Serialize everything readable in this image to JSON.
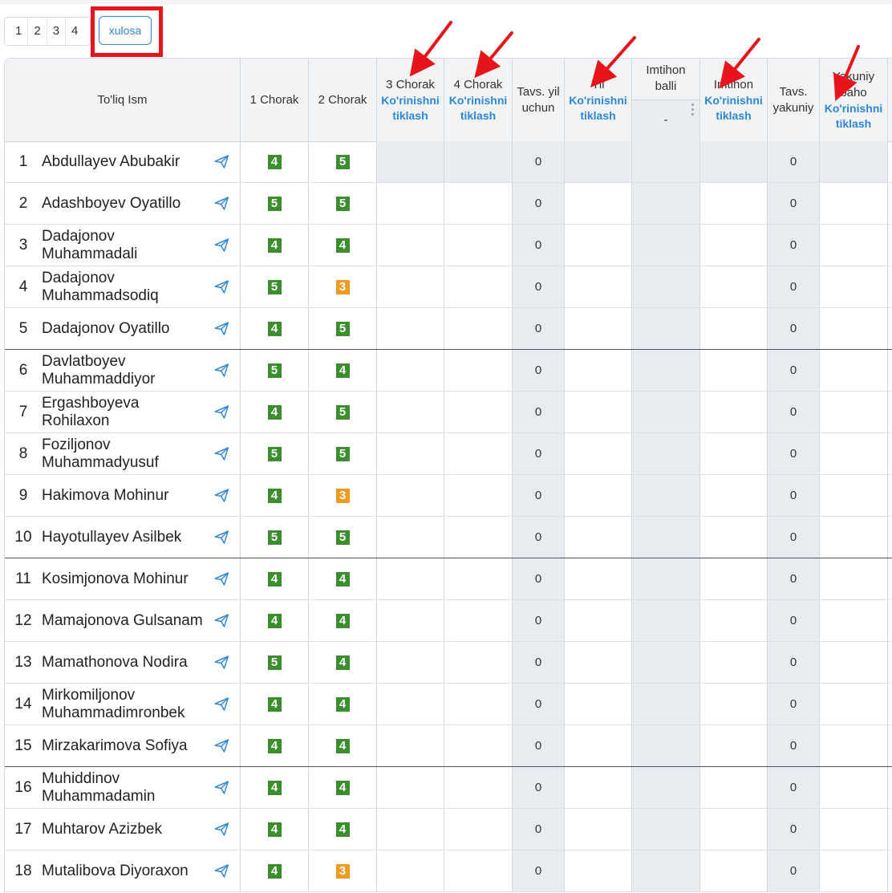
{
  "tabs": [
    {
      "label": "1"
    },
    {
      "label": "2"
    },
    {
      "label": "3"
    },
    {
      "label": "4"
    }
  ],
  "active_tab": "xulosa",
  "headers": {
    "name": "To'liq Ism",
    "q1": "1 Chorak",
    "q2": "2 Chorak",
    "q3": "3 Chorak",
    "q4": "4 Chorak",
    "recommended_year": "Tavs. yil uchun",
    "year": "Yil",
    "exam_score": "Imtihon balli",
    "exam_score_value": "-",
    "exam": "Imtihon",
    "recommended_final": "Tavs. yakuniy",
    "final_grade": "Yakuniy baho",
    "restore_view": "Ko'rinishni tiklash"
  },
  "colors": {
    "accent": "#2f86d8",
    "grade_good": "#3a8e2b",
    "grade_mid": "#f19a22",
    "annotation": "#e8141b"
  },
  "students": [
    {
      "n": "1",
      "name": "Abdullayev Abubakir",
      "q1": "4",
      "q2": "5",
      "rec_year": "0",
      "rec_final": "0"
    },
    {
      "n": "2",
      "name": "Adashboyev Oyatillo",
      "q1": "5",
      "q2": "5",
      "rec_year": "0",
      "rec_final": "0"
    },
    {
      "n": "3",
      "name": "Dadajonov Muhammadali",
      "q1": "4",
      "q2": "4",
      "rec_year": "0",
      "rec_final": "0"
    },
    {
      "n": "4",
      "name": "Dadajonov Muhammadsodiq",
      "q1": "5",
      "q2": "3",
      "rec_year": "0",
      "rec_final": "0"
    },
    {
      "n": "5",
      "name": "Dadajonov Oyatillo",
      "q1": "4",
      "q2": "5",
      "rec_year": "0",
      "rec_final": "0"
    },
    {
      "n": "6",
      "name": "Davlatboyev Muhammaddiyor",
      "q1": "5",
      "q2": "4",
      "rec_year": "0",
      "rec_final": "0"
    },
    {
      "n": "7",
      "name": "Ergashboyeva Rohilaxon",
      "q1": "4",
      "q2": "5",
      "rec_year": "0",
      "rec_final": "0"
    },
    {
      "n": "8",
      "name": "Foziljonov Muhammadyusuf",
      "q1": "5",
      "q2": "5",
      "rec_year": "0",
      "rec_final": "0"
    },
    {
      "n": "9",
      "name": "Hakimova Mohinur",
      "q1": "4",
      "q2": "3",
      "rec_year": "0",
      "rec_final": "0"
    },
    {
      "n": "10",
      "name": "Hayotullayev Asilbek",
      "q1": "5",
      "q2": "5",
      "rec_year": "0",
      "rec_final": "0"
    },
    {
      "n": "11",
      "name": "Kosimjonova Mohinur",
      "q1": "4",
      "q2": "4",
      "rec_year": "0",
      "rec_final": "0"
    },
    {
      "n": "12",
      "name": "Mamajonova Gulsanam",
      "q1": "4",
      "q2": "4",
      "rec_year": "0",
      "rec_final": "0"
    },
    {
      "n": "13",
      "name": "Mamathonova Nodira",
      "q1": "5",
      "q2": "4",
      "rec_year": "0",
      "rec_final": "0"
    },
    {
      "n": "14",
      "name": "Mirkomiljonov Muhammadimronbek",
      "q1": "4",
      "q2": "4",
      "rec_year": "0",
      "rec_final": "0"
    },
    {
      "n": "15",
      "name": "Mirzakarimova Sofiya",
      "q1": "4",
      "q2": "4",
      "rec_year": "0",
      "rec_final": "0"
    },
    {
      "n": "16",
      "name": "Muhiddinov Muhammadamin",
      "q1": "4",
      "q2": "4",
      "rec_year": "0",
      "rec_final": "0"
    },
    {
      "n": "17",
      "name": "Muhtarov Azizbek",
      "q1": "4",
      "q2": "4",
      "rec_year": "0",
      "rec_final": "0"
    },
    {
      "n": "18",
      "name": "Mutalibova Diyoraxon",
      "q1": "4",
      "q2": "3",
      "rec_year": "0",
      "rec_final": "0"
    }
  ]
}
